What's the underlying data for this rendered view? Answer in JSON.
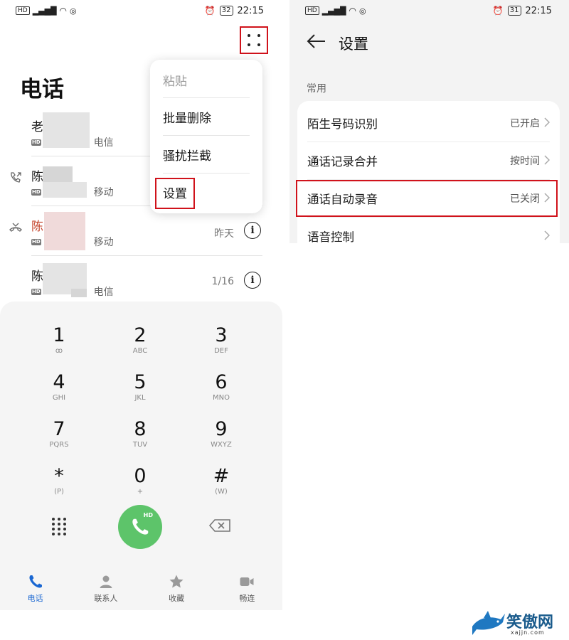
{
  "status_bar": {
    "left_chip": "HD",
    "signal": "⁴ᴳ",
    "time": "22:15",
    "battery_left": "32",
    "battery_right": "31"
  },
  "left": {
    "title": "电话",
    "menu": {
      "items": [
        "粘贴",
        "批量删除",
        "骚扰拦截",
        "设置"
      ]
    },
    "calls": [
      {
        "name": "老",
        "carrier": "电信",
        "date": "",
        "hd": "HD"
      },
      {
        "name": "陈",
        "carrier": "移动",
        "date": "",
        "hd": "HD"
      },
      {
        "name": "陈",
        "carrier": "移动",
        "date": "昨天",
        "hd": "HD",
        "missed": true
      },
      {
        "name": "陈",
        "carrier": "电信",
        "date": "1/16",
        "hd": "HD"
      }
    ],
    "info_glyph": "i",
    "keypad": [
      {
        "digit": "1",
        "letters": "⌂"
      },
      {
        "digit": "2",
        "letters": "ABC"
      },
      {
        "digit": "3",
        "letters": "DEF"
      },
      {
        "digit": "4",
        "letters": "GHI"
      },
      {
        "digit": "5",
        "letters": "JKL"
      },
      {
        "digit": "6",
        "letters": "MNO"
      },
      {
        "digit": "7",
        "letters": "PQRS"
      },
      {
        "digit": "8",
        "letters": "TUV"
      },
      {
        "digit": "9",
        "letters": "WXYZ"
      },
      {
        "digit": "*",
        "letters": "(P)"
      },
      {
        "digit": "0",
        "letters": "+"
      },
      {
        "digit": "#",
        "letters": "(W)"
      }
    ],
    "call_button_badge": "HD",
    "bottom_nav": [
      {
        "label": "电话",
        "icon": "phone-icon",
        "active": true
      },
      {
        "label": "联系人",
        "icon": "contacts-icon",
        "active": false
      },
      {
        "label": "收藏",
        "icon": "star-icon",
        "active": false
      },
      {
        "label": "畅连",
        "icon": "video-call-icon",
        "active": false
      }
    ]
  },
  "right": {
    "title": "设置",
    "section": "常用",
    "rows": [
      {
        "label": "陌生号码识别",
        "value": "已开启"
      },
      {
        "label": "通话记录合并",
        "value": "按时间"
      },
      {
        "label": "通话自动录音",
        "value": "已关闭"
      },
      {
        "label": "语音控制",
        "value": ""
      }
    ]
  },
  "watermark": {
    "text": "笑傲网",
    "url": "xajjn.com"
  },
  "colors": {
    "highlight": "#d0121b",
    "call_green": "#5dc46a",
    "nav_active": "#1a67d2",
    "missed": "#c4442b"
  }
}
